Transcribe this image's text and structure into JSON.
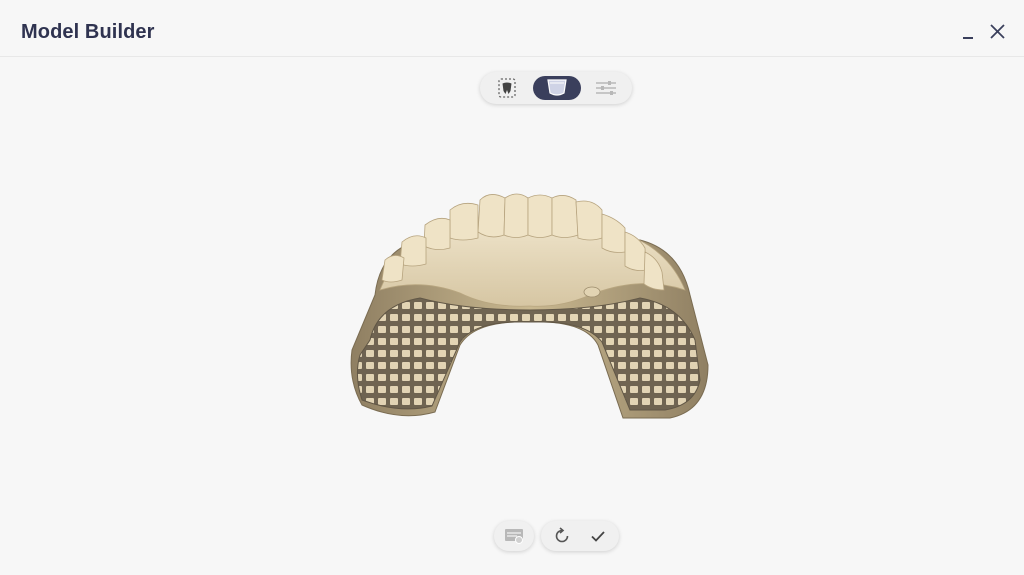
{
  "window": {
    "title": "Model Builder",
    "controls": [
      "minimize-icon",
      "close-icon"
    ]
  },
  "mode_toolbar": {
    "buttons": [
      {
        "icon": "tooth-selection-icon",
        "active": false
      },
      {
        "icon": "model-base-icon",
        "active": true
      },
      {
        "icon": "sliders-icon",
        "active": false
      }
    ],
    "active_color": "#3a3f5c"
  },
  "viewport": {
    "object": "dental-arch-model-with-lattice-base",
    "model_color": "#e4d7bb"
  },
  "bottom_toolbar": {
    "buttons": [
      {
        "icon": "base-settings-icon",
        "enabled": false
      },
      {
        "icon": "reset-icon",
        "enabled": true
      },
      {
        "icon": "confirm-check-icon",
        "enabled": true
      }
    ]
  },
  "colors": {
    "title": "#2f3350",
    "background": "#f7f7f7",
    "accent": "#3a3f5c"
  }
}
